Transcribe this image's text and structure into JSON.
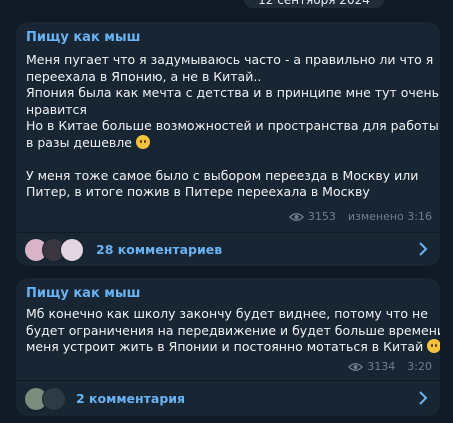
{
  "date_separator": "12 сентября 2024",
  "messages": [
    {
      "sender": "Пищу как мыш",
      "lines": [
        "Меня пугает что я задумываюсь часто - а правильно ли что я",
        "переехала в Японию, а не в Китай..",
        "Япония была как мечта с детства и в принципе мне тут очень",
        "нравится",
        "Но в Китае больше возможностей и пространства для работы и",
        "в разы дешевле",
        "",
        "У меня тоже самое было с выбором переезда в Москву или",
        "Питер, в итоге пожив в Питере переехала в Москву"
      ],
      "views": "3153",
      "edited": "изменено 3:16",
      "comments_label": "28 комментариев",
      "icons": {
        "views": "eye-icon",
        "emoji": "crying-face-emoji",
        "chevron": "chevron-right-icon"
      }
    },
    {
      "sender": "Пищу как мыш",
      "lines": [
        "Мб конечно как школу закончу будет виднее, потому что не",
        "будет ограничения на передвижение и будет больше времени, и",
        "меня устроит жить в Японии и постоянно мотаться в Китай"
      ],
      "views": "3134",
      "time": "3:20",
      "comments_label": "2 комментария",
      "icons": {
        "views": "eye-icon",
        "emoji": "crying-face-emoji",
        "chevron": "chevron-right-icon"
      }
    }
  ],
  "colors": {
    "background": "#0f1a24",
    "bubble": "#182533",
    "sender": "#6ab3f3",
    "text": "#f0f3f6",
    "meta": "#6d7f8f",
    "link": "#6ab3f3"
  }
}
